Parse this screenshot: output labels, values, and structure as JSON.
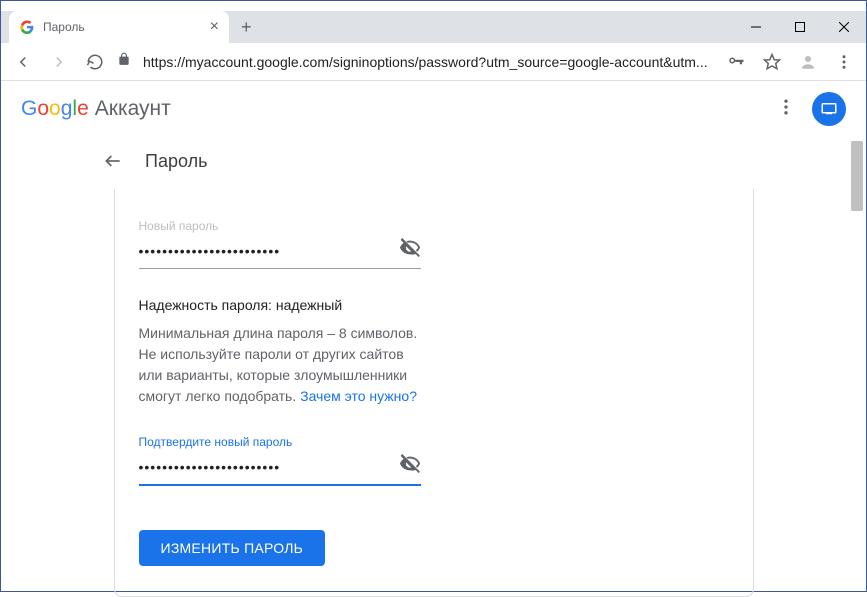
{
  "browser": {
    "tab_title": "Пароль",
    "url_display": "https://myaccount.google.com/signinoptions/password?utm_source=google-account&utm..."
  },
  "header": {
    "logo_text": "Google",
    "account_label": "Аккаунт"
  },
  "sub_header": {
    "title": "Пароль"
  },
  "form": {
    "new_password_label": "Новый пароль",
    "new_password_value": "••••••••••••••••••••••••",
    "strength_label": "Надежность пароля:",
    "strength_value": "надежный",
    "hint_line1": "Минимальная длина пароля – 8 символов.",
    "hint_line2": "Не используйте пароли от других сайтов или варианты, которые злоумышленники смогут легко подобрать.",
    "hint_link": "Зачем это нужно?",
    "confirm_label": "Подтвердите новый пароль",
    "confirm_value": "••••••••••••••••••••••••",
    "submit_label": "ИЗМЕНИТЬ ПАРОЛЬ"
  }
}
